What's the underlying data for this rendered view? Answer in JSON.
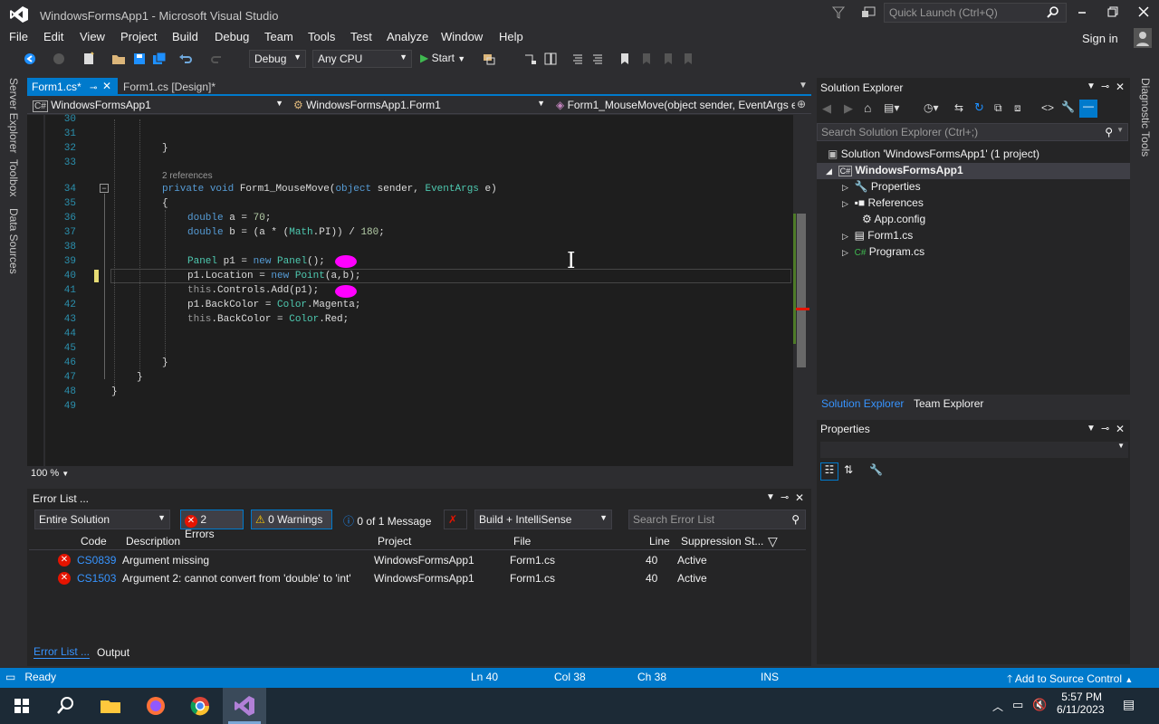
{
  "window": {
    "title": "WindowsFormsApp1 - Microsoft Visual Studio",
    "quick_launch_placeholder": "Quick Launch (Ctrl+Q)",
    "sign_in": "Sign in"
  },
  "menu": [
    "File",
    "Edit",
    "View",
    "Project",
    "Build",
    "Debug",
    "Team",
    "Tools",
    "Test",
    "Analyze",
    "Window",
    "Help"
  ],
  "toolbar": {
    "config": "Debug",
    "platform": "Any CPU",
    "start": "Start"
  },
  "left_tabs": [
    "Server Explorer",
    "Toolbox",
    "Data Sources"
  ],
  "right_tabs": [
    "Diagnostic Tools"
  ],
  "editor_tabs": [
    {
      "label": "Form1.cs*",
      "active": true
    },
    {
      "label": "Form1.cs [Design]*",
      "active": false
    }
  ],
  "nav": {
    "project": "WindowsFormsApp1",
    "class": "WindowsFormsApp1.Form1",
    "member": "Form1_MouseMove(object sender, EventArgs e"
  },
  "code": {
    "line_numbers": [
      "30",
      "31",
      "32",
      "33",
      "34",
      "35",
      "36",
      "37",
      "38",
      "39",
      "40",
      "41",
      "42",
      "43",
      "44",
      "45",
      "46",
      "47",
      "48",
      "49"
    ],
    "references": "2 references",
    "l32": "}",
    "l34a": "private",
    "l34b": "void",
    "l34c": " Form1_MouseMove(",
    "l34d": "object",
    "l34e": " sender, ",
    "l34f": "EventArgs",
    "l34g": " e)",
    "l35": "{",
    "l36a": "double",
    "l36b": " a = ",
    "l36c": "70",
    "l36d": ";",
    "l37a": "double",
    "l37b": " b = (a * (",
    "l37c": "Math",
    "l37d": ".PI)) / ",
    "l37e": "180",
    "l37f": ";",
    "l39a": "Panel",
    "l39b": " p1 = ",
    "l39c": "new",
    "l39d": " ",
    "l39e": "Panel",
    "l39f": "();",
    "l40a": "p1.Location = ",
    "l40b": "new",
    "l40c": " ",
    "l40d": "Point",
    "l40e": "(a,b);",
    "l41a": "this",
    "l41b": ".Controls.Add(p1);",
    "l42a": "p1.BackColor = ",
    "l42b": "Color",
    "l42c": ".Magenta;",
    "l43a": "this",
    "l43b": ".BackColor = ",
    "l43c": "Color",
    "l43d": ".Red;",
    "l46": "}",
    "l47": "}",
    "l48": "}"
  },
  "zoom": "100 %",
  "error_list": {
    "title": "Error List ...",
    "scope": "Entire Solution",
    "errors_btn": "2 Errors",
    "warnings_btn": "0 Warnings",
    "messages_btn": "0 of 1 Message",
    "build_filter": "Build + IntelliSense",
    "search_placeholder": "Search Error List",
    "columns": [
      "Code",
      "Description",
      "Project",
      "File",
      "Line",
      "Suppression St..."
    ],
    "rows": [
      {
        "code": "CS0839",
        "description": "Argument missing",
        "project": "WindowsFormsApp1",
        "file": "Form1.cs",
        "line": "40",
        "suppression": "Active"
      },
      {
        "code": "CS1503",
        "description": "Argument 2: cannot convert from 'double' to 'int'",
        "project": "WindowsFormsApp1",
        "file": "Form1.cs",
        "line": "40",
        "suppression": "Active"
      }
    ],
    "bottom_tabs": [
      "Error List ...",
      "Output"
    ]
  },
  "solution_explorer": {
    "title": "Solution Explorer",
    "search_placeholder": "Search Solution Explorer (Ctrl+;)",
    "solution": "Solution 'WindowsFormsApp1' (1 project)",
    "project": "WindowsFormsApp1",
    "items": [
      "Properties",
      "References",
      "App.config",
      "Form1.cs",
      "Program.cs"
    ],
    "tabs": [
      "Solution Explorer",
      "Team Explorer"
    ]
  },
  "properties": {
    "title": "Properties"
  },
  "status": {
    "ready": "Ready",
    "ln": "Ln 40",
    "col": "Col 38",
    "ch": "Ch 38",
    "mode": "INS",
    "source_control": "Add to Source Control"
  },
  "taskbar": {
    "time": "5:57 PM",
    "date": "6/11/2023"
  },
  "colors": {
    "accent": "#007acc",
    "error": "#e51400",
    "magenta": "#ff00ff"
  }
}
